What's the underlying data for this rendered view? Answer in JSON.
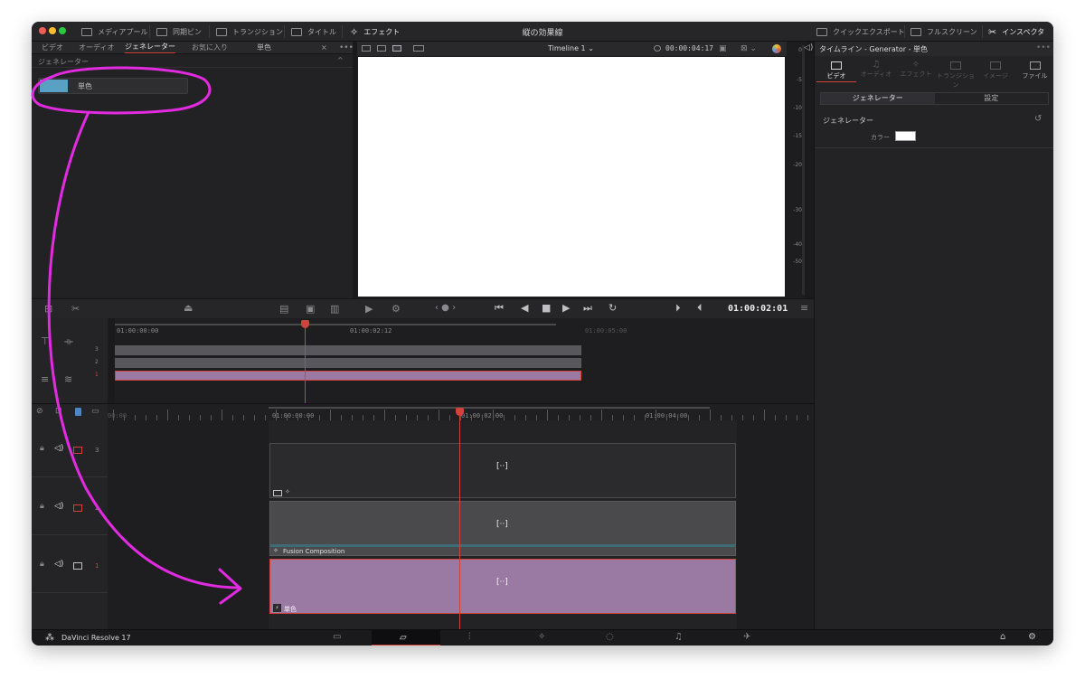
{
  "window": {
    "title": "縦の効果線"
  },
  "toolbar": {
    "items": [
      "メディアプール",
      "同期ビン",
      "トランジション",
      "タイトル",
      "エフェクト"
    ],
    "right_items": [
      "クイックエクスポート",
      "フルスクリーン",
      "インスペクタ"
    ]
  },
  "library": {
    "tabs": [
      "ビデオ",
      "オーディオ",
      "ジェネレーター",
      "お気に入り"
    ],
    "active_tab": "ジェネレーター",
    "search_tag": "単色",
    "close": "×",
    "more": "•••",
    "section_title": "ジェネレーター",
    "collapse": "^",
    "items": [
      {
        "label": "単色",
        "color": "#58a0c4"
      }
    ]
  },
  "viewer": {
    "timeline_name": "Timeline 1",
    "duration": "00:00:04:17",
    "timecode": "01:00:02:01",
    "audio_meter_ticks": [
      "0",
      "-5",
      "-10",
      "-15",
      "-20",
      "-30",
      "-40",
      "-50"
    ]
  },
  "inspector": {
    "title": "タイムライン - Generator - 単色",
    "tabs": [
      "ビデオ",
      "オーディオ",
      "エフェクト",
      "トランジション",
      "イメージ",
      "ファイル"
    ],
    "subtabs": [
      "ジェネレーター",
      "設定"
    ],
    "section": "ジェネレーター",
    "color_label": "カラー",
    "color_value": "#ffffff"
  },
  "mini_timeline": {
    "ruler": [
      "01:00:00:00",
      "01:00:02:12",
      "01:00:05:00"
    ],
    "tracks": [
      "3",
      "2",
      "1"
    ]
  },
  "timeline": {
    "ruler": [
      "00:00",
      "01:00:00:00",
      "01:00:02:00",
      "01:00:04:00"
    ],
    "tracks": [
      {
        "num": "3",
        "clip_label": "",
        "clip_color": "#2b2b2e"
      },
      {
        "num": "2",
        "clip_label": "Fusion Composition",
        "clip_color": "#4a4a4d"
      },
      {
        "num": "1",
        "clip_label": "単色",
        "clip_color": "#9a79a2"
      }
    ],
    "clip_icon": "[··]"
  },
  "status": {
    "app_name": "DaVinci Resolve 17"
  },
  "colors": {
    "accent_red": "#d0433a",
    "annotation": "#e22be0",
    "selected_clip": "#9a79a2"
  }
}
